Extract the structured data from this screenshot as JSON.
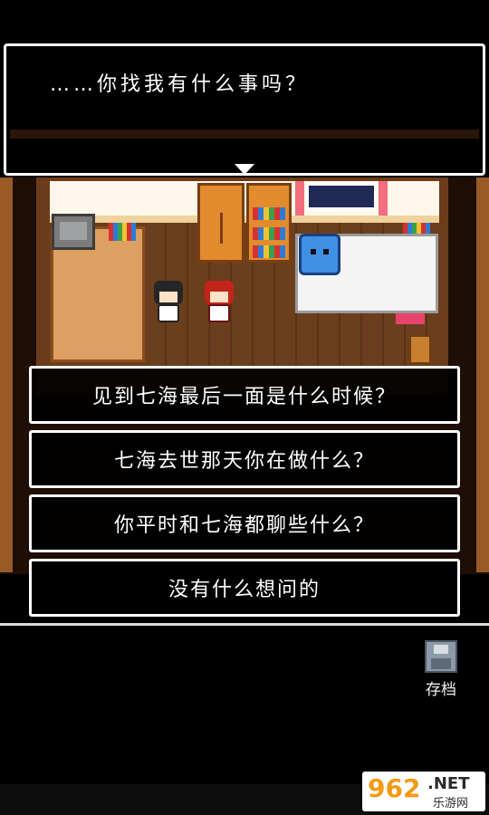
{
  "dialog": {
    "text": "……你找我有什么事吗？"
  },
  "choices": [
    {
      "label": "见到七海最后一面是什么时候？"
    },
    {
      "label": "七海去世那天你在做什么？"
    },
    {
      "label": "你平时和七海都聊些什么？"
    },
    {
      "label": "没有什么想问的"
    }
  ],
  "save": {
    "label": "存档"
  },
  "watermark": {
    "number": "962",
    "suffix": ".NET",
    "site": "乐游网"
  },
  "colors": {
    "dialog_border": "#ffffff",
    "floor": "#6b3f1d",
    "wall": "#fff8ea",
    "accent_watermark": "#f29a16"
  }
}
